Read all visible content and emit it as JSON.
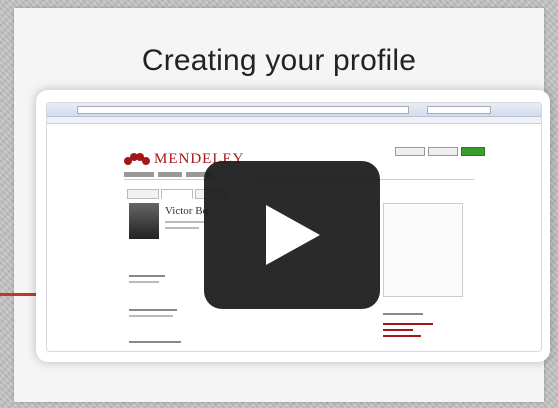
{
  "slide": {
    "title": "Creating your profile"
  },
  "video": {
    "play_label": "Play video",
    "logo_text": "MENDELEY",
    "profile_name": "Victor Bo",
    "colors": {
      "accent": "#a4161a",
      "play_bg": "#1a1a1a"
    }
  }
}
